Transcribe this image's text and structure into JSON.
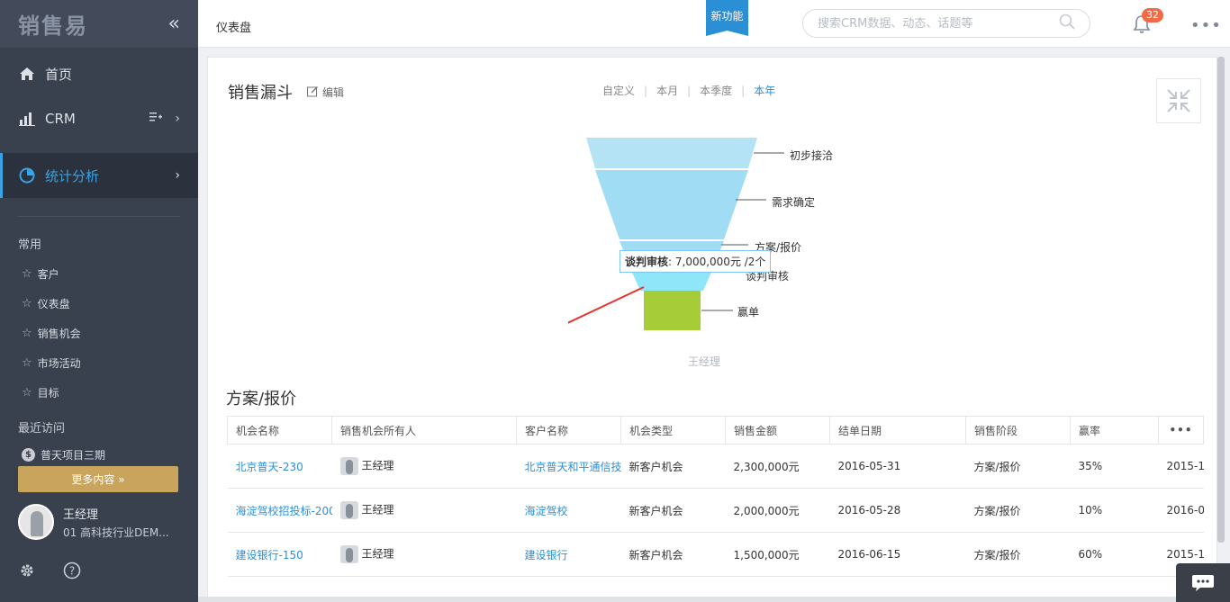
{
  "sidebar": {
    "logo": "销售易",
    "collapse_icon": "double-chevron-left-icon",
    "nav": [
      {
        "label": "首页",
        "icon": "home-icon"
      },
      {
        "label": "CRM",
        "icon": "bar-chart-icon"
      },
      {
        "label": "统计分析",
        "icon": "pie-chart-icon"
      }
    ],
    "common_title": "常用",
    "common": [
      "客户",
      "仪表盘",
      "销售机会",
      "市场活动",
      "目标"
    ],
    "recent_title": "最近访问",
    "recent": [
      "普天项目三期"
    ],
    "more_label": "更多内容",
    "user": {
      "name": "王经理",
      "org": "01 高科技行业DEM..."
    }
  },
  "topbar": {
    "breadcrumb": "仪表盘",
    "new_feature": "新功能",
    "search_placeholder": "搜索CRM数据、动态、话题等",
    "notification_count": "32"
  },
  "panel": {
    "title": "销售漏斗",
    "edit_label": "编辑",
    "ranges": [
      "自定义",
      "本月",
      "本季度",
      "本年"
    ],
    "selected_range": "本年",
    "owner": "王经理",
    "tooltip": {
      "stage": "谈判审核",
      "value": ": 7,000,000元 /2个"
    },
    "section_title": "方案/报价"
  },
  "chart_data": {
    "type": "funnel",
    "stages": [
      {
        "name": "初步接洽",
        "color": "#b3e3f4"
      },
      {
        "name": "需求确定",
        "color": "#a0dcf4"
      },
      {
        "name": "方案/报价",
        "color": "#a0dcf4"
      },
      {
        "name": "谈判审核",
        "color": "#8fe6f8"
      },
      {
        "name": "赢单",
        "color": "#a6cc38"
      }
    ]
  },
  "table": {
    "headers": [
      "机会名称",
      "销售机会所有人",
      "客户名称",
      "机会类型",
      "销售金额",
      "结单日期",
      "销售阶段",
      "赢率",
      ""
    ],
    "rows": [
      [
        "北京普天-230",
        "王经理",
        "北京普天和平通信技",
        "新客户机会",
        "2,300,000元",
        "2016-05-31",
        "方案/报价",
        "35%",
        "2015-1"
      ],
      [
        "海淀驾校招投标-200",
        "王经理",
        "海淀驾校",
        "新客户机会",
        "2,000,000元",
        "2016-05-28",
        "方案/报价",
        "10%",
        "2016-0"
      ],
      [
        "建设银行-150",
        "王经理",
        "建设银行",
        "新客户机会",
        "1,500,000元",
        "2016-06-15",
        "方案/报价",
        "60%",
        "2015-1"
      ]
    ]
  }
}
